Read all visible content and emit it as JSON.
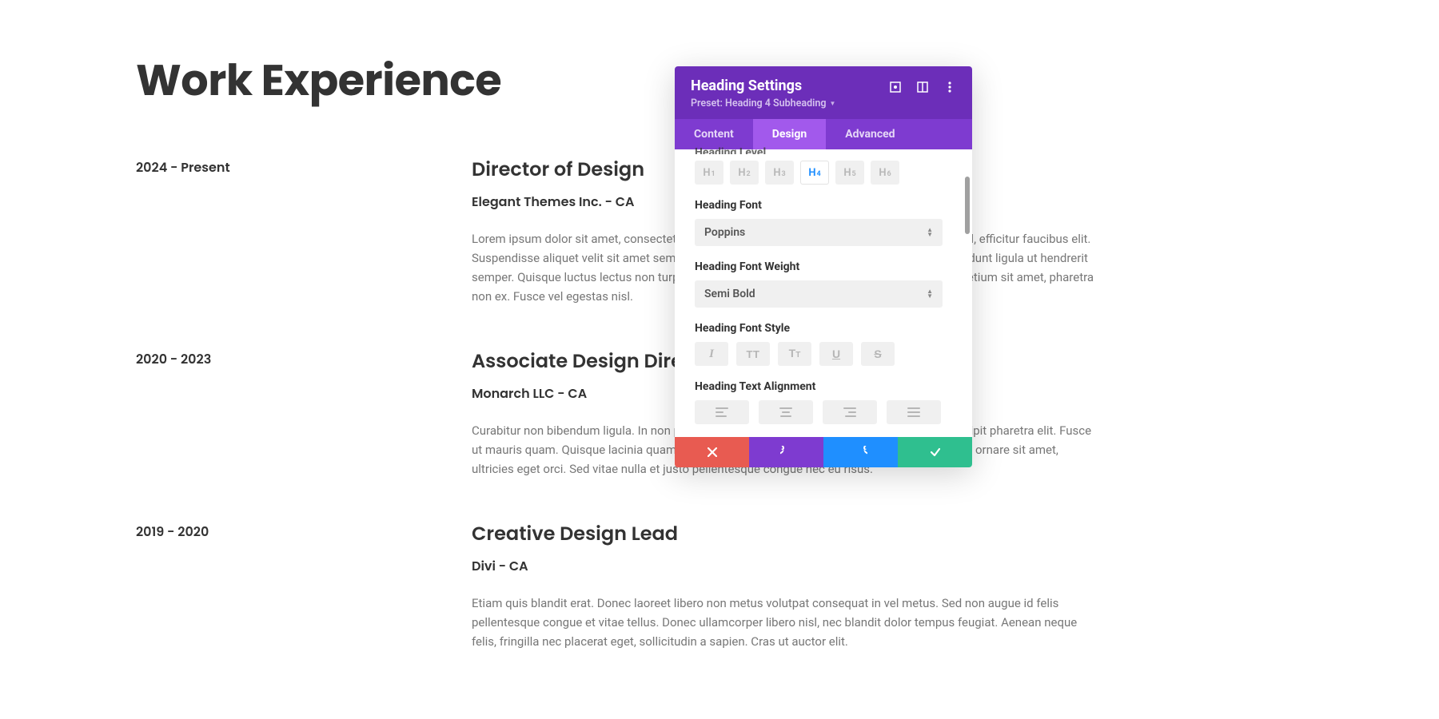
{
  "page": {
    "title": "Work Experience",
    "jobs": [
      {
        "dates": "2024 - Present",
        "title": "Director of Design",
        "subtitle": "Elegant Themes Inc. - CA",
        "desc": "Lorem ipsum dolor sit amet, consectetur adipiscing elit. Donec dui enim, pharetra ut magna vel, efficitur faucibus elit. Suspendisse aliquet velit sit amet sem interdum faucibus. In feugiat aliquet mollis. Etiam tincidunt ligula ut hendrerit semper. Quisque luctus lectus non turpis bibendum posuere. Morbi tortor nibh, fringilla sed pretium sit amet, pharetra non ex. Fusce vel egestas nisl."
      },
      {
        "dates": "2020 - 2023",
        "title": "Associate Design Director",
        "subtitle": "Monarch LLC - CA",
        "desc": "Curabitur non bibendum ligula. In non pulvinar purus. Curabitur nisi odio, blandit et elit at, suscipit pharetra elit. Fusce ut mauris quam. Quisque lacinia quam eu commodo mollis. Praesent nisl massa, ultrices vitae ornare sit amet, ultricies eget orci. Sed vitae nulla et justo pellentesque congue nec eu risus."
      },
      {
        "dates": "2019 - 2020",
        "title": "Creative Design Lead",
        "subtitle": "Divi - CA",
        "desc": "Etiam quis blandit erat. Donec laoreet libero non metus volutpat consequat in vel metus. Sed non augue id felis pellentesque congue et vitae tellus. Donec ullamcorper libero nisl, nec blandit dolor tempus feugiat. Aenean neque felis, fringilla nec placerat eget, sollicitudin a sapien. Cras ut auctor elit."
      }
    ]
  },
  "modal": {
    "title": "Heading Settings",
    "preset_label": "Preset: Heading 4 Subheading",
    "tabs": {
      "content": "Content",
      "design": "Design",
      "advanced": "Advanced",
      "active": "design"
    },
    "sections": {
      "heading_level": {
        "label": "Heading Level",
        "options": [
          "1",
          "2",
          "3",
          "4",
          "5",
          "6"
        ],
        "active": "4"
      },
      "heading_font": {
        "label": "Heading Font",
        "value": "Poppins"
      },
      "heading_weight": {
        "label": "Heading Font Weight",
        "value": "Semi Bold"
      },
      "heading_style": {
        "label": "Heading Font Style"
      },
      "heading_align": {
        "label": "Heading Text Alignment"
      }
    }
  }
}
